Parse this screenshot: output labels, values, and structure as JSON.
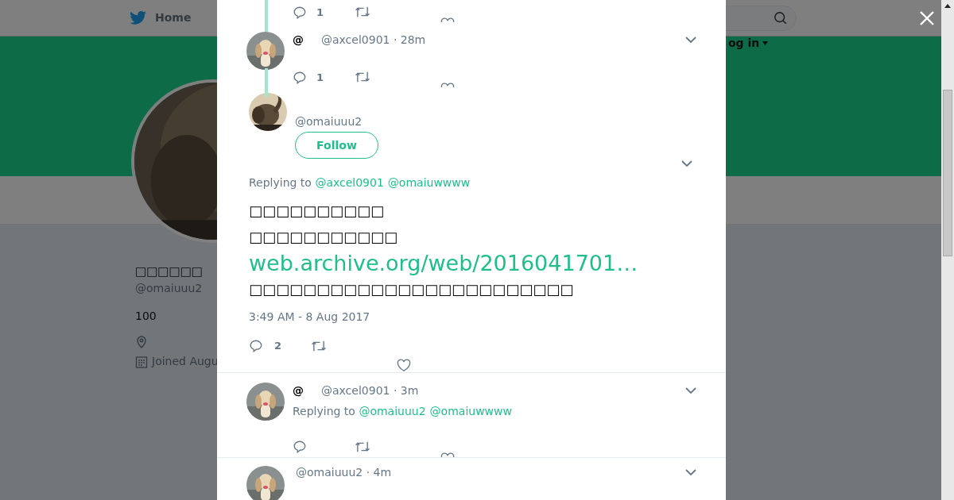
{
  "page": {
    "nav": {
      "home": "Home",
      "login": "og in"
    },
    "profile": {
      "name": "□□□□□□",
      "handle": "@omaiuuu2",
      "stat": "100",
      "joined": "Joined Augu"
    }
  },
  "modal": {
    "tweets": [
      {
        "kind": "cut_top",
        "replies": "1"
      },
      {
        "kind": "reply",
        "name": "@",
        "handle": "@axcel0901",
        "time": "· 28m",
        "replies": "1"
      },
      {
        "kind": "focus",
        "handle": "@omaiuuu2",
        "follow": "Follow",
        "replying": "Replying to",
        "mentions": [
          "@axcel0901",
          "@omaiuwwww"
        ],
        "lines": [
          {
            "kind": "text",
            "text": "□□□□□□□□□□"
          },
          {
            "kind": "text",
            "text": "□□□□□□□□□□□"
          },
          {
            "kind": "link",
            "text": "web.archive.org/web/2016041701…"
          },
          {
            "kind": "text",
            "text": "□□□□□□□□□□□□□□□□□□□□□□□□"
          }
        ],
        "timestamp": "3:49 AM - 8 Aug 2017",
        "replies": "2"
      },
      {
        "kind": "reply",
        "name": "@",
        "handle": "@axcel0901",
        "time": "· 3m",
        "replying": "Replying to",
        "mentions": [
          "@omaiuuu2",
          "@omaiuwwww"
        ]
      },
      {
        "kind": "cut_bottom",
        "handle": "@omaiuuu2",
        "time": "· 4m"
      }
    ]
  }
}
